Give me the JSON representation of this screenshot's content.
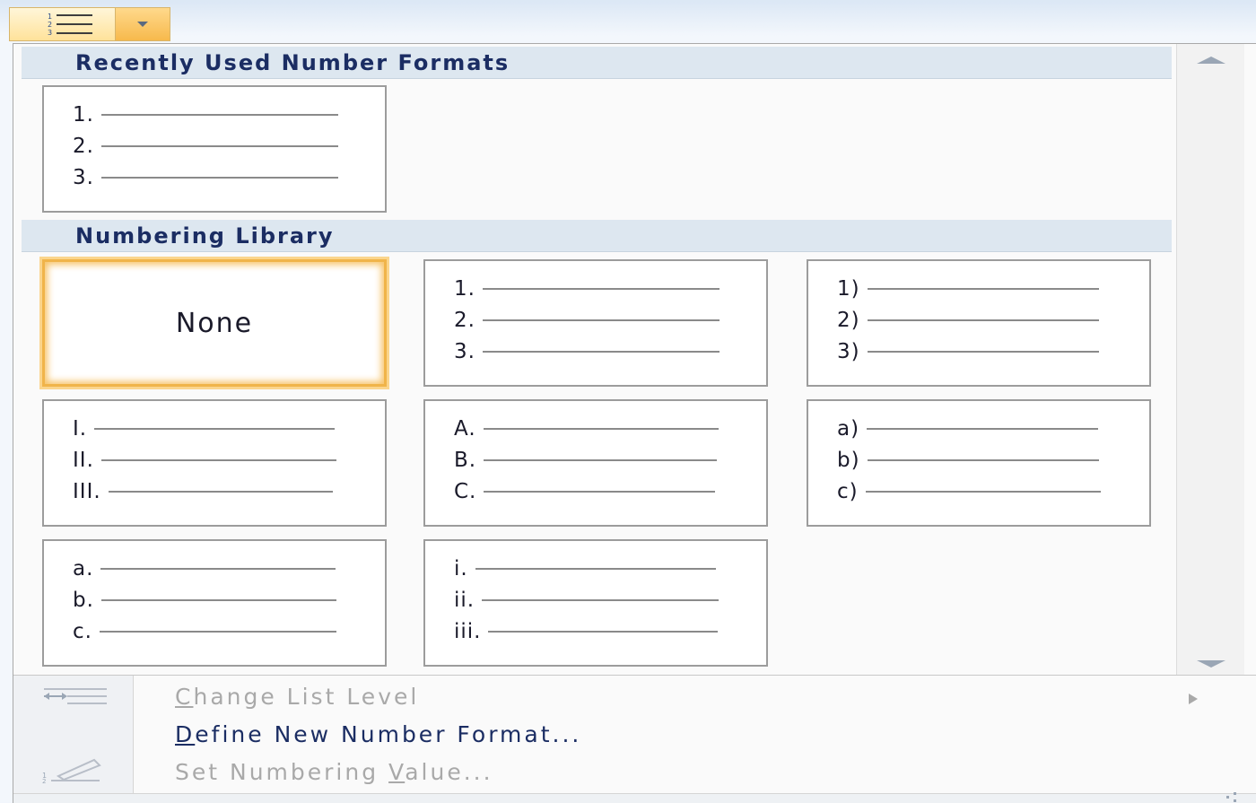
{
  "toolbar": {
    "numbering_button": "Numbering",
    "dropdown_button": "Numbering options"
  },
  "gallery": {
    "recent_header": "Recently Used Number Formats",
    "library_header": "Numbering Library",
    "recent": [
      {
        "lines": [
          "1.",
          "2.",
          "3."
        ]
      }
    ],
    "library": [
      {
        "none_label": "None",
        "selected": true
      },
      {
        "lines": [
          "1.",
          "2.",
          "3."
        ]
      },
      {
        "lines": [
          "1)",
          "2)",
          "3)"
        ]
      },
      {
        "lines": [
          "I.",
          "II.",
          "III."
        ]
      },
      {
        "lines": [
          "A.",
          "B.",
          "C."
        ]
      },
      {
        "lines": [
          "a)",
          "b)",
          "c)"
        ]
      },
      {
        "lines": [
          "a.",
          "b.",
          "c."
        ]
      },
      {
        "lines": [
          "i.",
          "ii.",
          "iii."
        ]
      }
    ]
  },
  "menu": {
    "change_list_level": {
      "prefix": "",
      "accel": "C",
      "rest": "hange List Level",
      "enabled": false
    },
    "define_new_number_format": {
      "accel": "D",
      "rest": "efine New Number Format...",
      "enabled": true
    },
    "set_numbering_value": {
      "prefix": "Set Numbering ",
      "accel": "V",
      "rest": "alue...",
      "enabled": false
    }
  },
  "colors": {
    "header_text": "#1b2d63",
    "header_bg": "#dde7f0",
    "selected_border": "#f0b44a"
  }
}
